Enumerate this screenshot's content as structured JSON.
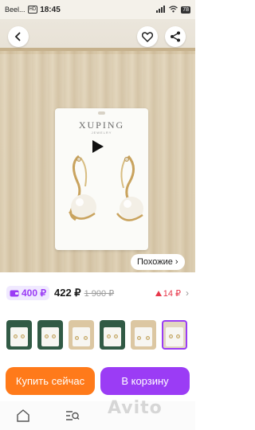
{
  "status_bar": {
    "carrier": "Beel...",
    "hd": "HD",
    "time": "18:45",
    "battery": "78"
  },
  "product_card": {
    "brand": "XUPING",
    "brand_sub": "JEWELRY"
  },
  "similar": {
    "label": "Похожие"
  },
  "price": {
    "discount_price": "400 ₽",
    "current_price": "422 ₽",
    "old_price": "1 900 ₽",
    "delta": "14 ₽"
  },
  "thumbnails": {
    "count": 6,
    "selected_index": 5
  },
  "actions": {
    "buy_now": "Купить сейчас",
    "add_to_cart": "В корзину"
  },
  "watermark": "Avito",
  "colors": {
    "accent_purple": "#9b3cf5",
    "accent_orange": "#ff7a1a",
    "price_down_red": "#e7374a"
  }
}
